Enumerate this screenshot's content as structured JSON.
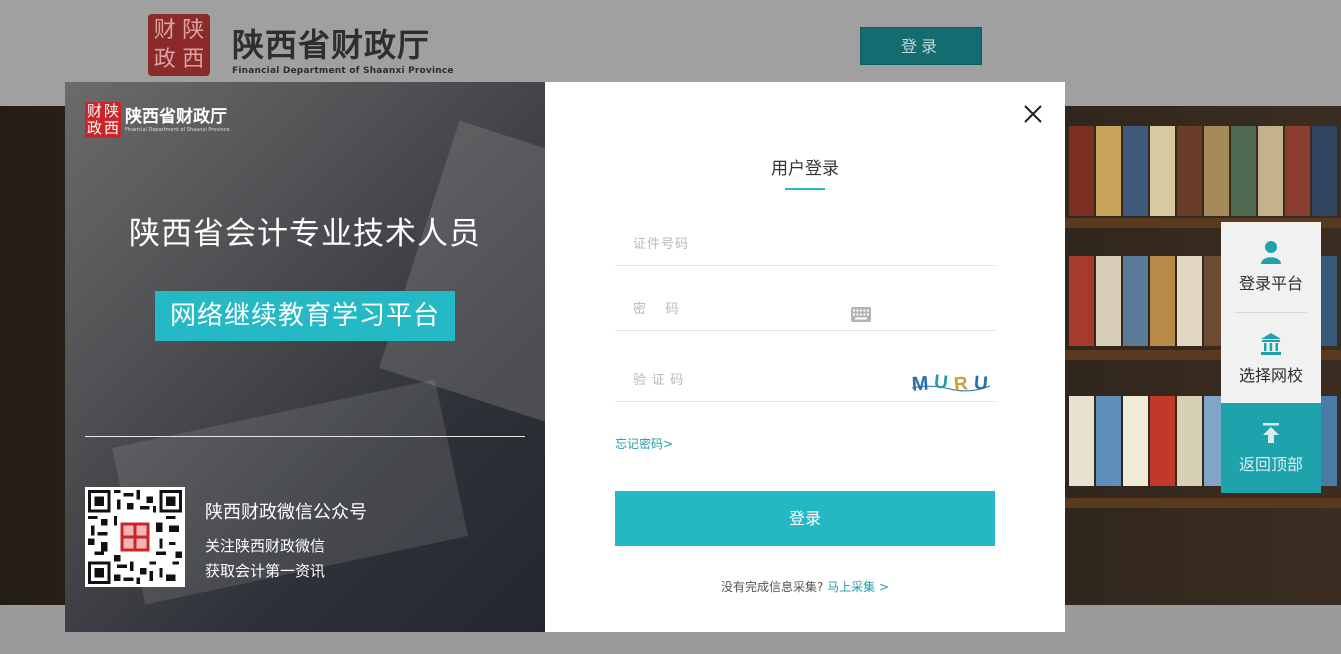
{
  "header": {
    "seal_chars": [
      "财",
      "陕",
      "政",
      "西"
    ],
    "brand_cn": "陕西省财政厅",
    "brand_en": "Financial Department of Shaanxi Province",
    "login_button": "登录"
  },
  "sidebar": {
    "items": [
      {
        "label": "登录平台",
        "icon": "user-icon"
      },
      {
        "label": "选择网校",
        "icon": "institution-icon"
      },
      {
        "label": "返回顶部",
        "icon": "back-to-top-icon"
      }
    ]
  },
  "modal": {
    "left": {
      "seal_chars": [
        "财",
        "陕",
        "政",
        "西"
      ],
      "brand_cn": "陕西省财政厅",
      "brand_en": "Financial Department of Shaanxi Province",
      "title": "陕西省会计专业技术人员",
      "badge": "网络继续教育学习平台",
      "wechat_title": "陕西财政微信公众号",
      "wechat_line1": "关注陕西财政微信",
      "wechat_line2": "获取会计第一资讯"
    },
    "right": {
      "title": "用户登录",
      "id_placeholder": "证件号码",
      "password_placeholder": "密　 码",
      "captcha_placeholder": "验 证 码",
      "captcha_text": "MURU",
      "forgot_link": "忘记密码>",
      "login_button": "登录",
      "collect_text": "没有完成信息采集?",
      "collect_link": "马上采集 >"
    }
  },
  "colors": {
    "accent": "#25b9c6",
    "link": "#1e9ea9",
    "seal_red": "#c9262b"
  }
}
